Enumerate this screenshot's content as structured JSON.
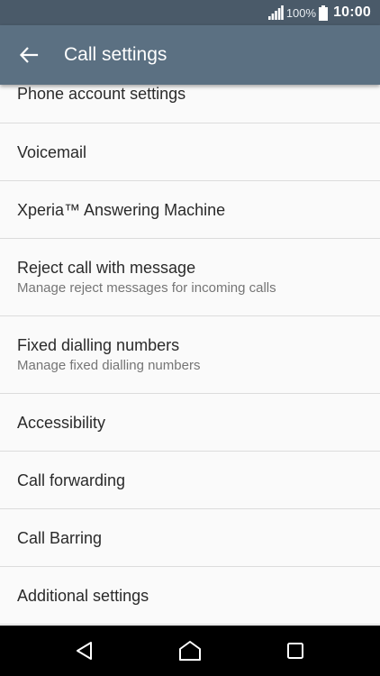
{
  "status_bar": {
    "battery_percent": "100%",
    "time": "10:00",
    "signal_icon": "signal-icon",
    "battery_icon": "battery-icon"
  },
  "app_bar": {
    "title": "Call settings",
    "back_icon": "arrow-back-icon"
  },
  "colors": {
    "status_bar": "#4a5a69",
    "app_bar": "#5b7082",
    "background": "#fafafa",
    "divider": "#dcdcdc",
    "primary_text": "#2a2a2a",
    "secondary_text": "#757575",
    "nav_bar": "#000000"
  },
  "settings": {
    "items": [
      {
        "title": "Phone account settings"
      },
      {
        "title": "Voicemail"
      },
      {
        "title": "Xperia™ Answering Machine"
      },
      {
        "title": "Reject call with message",
        "subtitle": "Manage reject messages for incoming calls"
      },
      {
        "title": "Fixed dialling numbers",
        "subtitle": "Manage fixed dialling numbers"
      },
      {
        "title": "Accessibility"
      },
      {
        "title": "Call forwarding"
      },
      {
        "title": "Call Barring"
      },
      {
        "title": "Additional settings"
      }
    ]
  },
  "nav_bar": {
    "back_icon": "nav-back-icon",
    "home_icon": "nav-home-icon",
    "recents_icon": "nav-recents-icon"
  }
}
